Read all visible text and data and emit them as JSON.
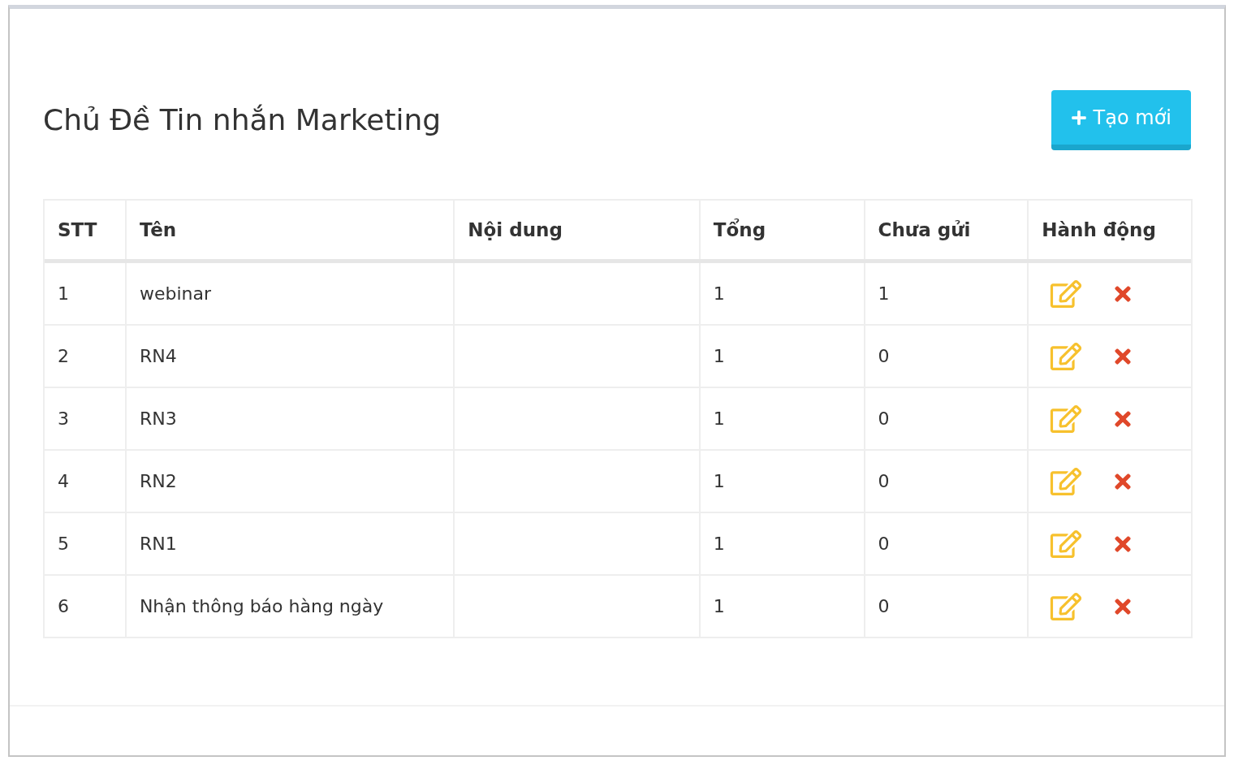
{
  "title": "Chủ Đề Tin nhắn Marketing",
  "create_button": {
    "label": "Tạo mới"
  },
  "table": {
    "columns": [
      "STT",
      "Tên",
      "Nội dung",
      "Tổng",
      "Chưa gửi",
      "Hành động"
    ],
    "rows": [
      {
        "stt": "1",
        "name": "webinar",
        "total": "1",
        "unsent": "1"
      },
      {
        "stt": "2",
        "name": "RN4",
        "total": "1",
        "unsent": "0"
      },
      {
        "stt": "3",
        "name": "RN3",
        "total": "1",
        "unsent": "0"
      },
      {
        "stt": "4",
        "name": "RN2",
        "total": "1",
        "unsent": "0"
      },
      {
        "stt": "5",
        "name": "RN1",
        "total": "1",
        "unsent": "0"
      },
      {
        "stt": "6",
        "name": "Nhận thông báo hàng ngày",
        "total": "1",
        "unsent": "0"
      }
    ]
  }
}
